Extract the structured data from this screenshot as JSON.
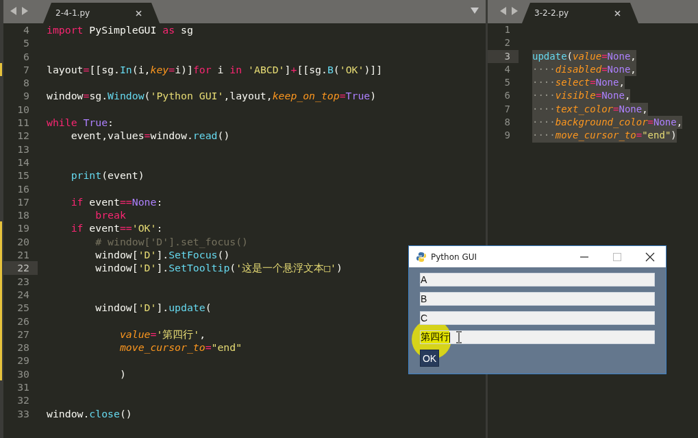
{
  "panes": [
    {
      "tabs": [
        {
          "label": "2-4-1.py",
          "selected": true
        }
      ],
      "lines": [
        {
          "number": "4",
          "current": false,
          "modified": false,
          "tokens": [
            {
              "text": "import",
              "kind": "kw"
            },
            {
              "text": " PySimpleGUI ",
              "kind": "plain"
            },
            {
              "text": "as",
              "kind": "kw"
            },
            {
              "text": " sg",
              "kind": "plain"
            }
          ]
        },
        {
          "number": "5",
          "current": false,
          "modified": false
        },
        {
          "number": "6",
          "current": false,
          "modified": false
        },
        {
          "number": "7",
          "current": false,
          "modified": true,
          "tokens": [
            {
              "text": "layout",
              "kind": "plain"
            },
            {
              "text": "=",
              "kind": "op"
            },
            {
              "text": "[[sg.",
              "kind": "plain"
            },
            {
              "text": "In",
              "kind": "fn"
            },
            {
              "text": "(i,",
              "kind": "plain"
            },
            {
              "text": "key",
              "kind": "param"
            },
            {
              "text": "=",
              "kind": "op"
            },
            {
              "text": "i)]",
              "kind": "plain"
            },
            {
              "text": "for",
              "kind": "kw"
            },
            {
              "text": " i ",
              "kind": "plain"
            },
            {
              "text": "in",
              "kind": "kw"
            },
            {
              "text": " 'ABCD'",
              "kind": "str"
            },
            {
              "text": "]",
              "kind": "plain"
            },
            {
              "text": "+",
              "kind": "op"
            },
            {
              "text": "[[sg.",
              "kind": "plain"
            },
            {
              "text": "B",
              "kind": "fn"
            },
            {
              "text": "(",
              "kind": "plain"
            },
            {
              "text": "'OK'",
              "kind": "str"
            },
            {
              "text": ")]]",
              "kind": "plain"
            }
          ]
        },
        {
          "number": "8",
          "current": false,
          "modified": false
        },
        {
          "number": "9",
          "current": false,
          "modified": false,
          "tokens": [
            {
              "text": "window",
              "kind": "plain"
            },
            {
              "text": "=",
              "kind": "op"
            },
            {
              "text": "sg.",
              "kind": "plain"
            },
            {
              "text": "Window",
              "kind": "fn"
            },
            {
              "text": "(",
              "kind": "plain"
            },
            {
              "text": "'Python GUI'",
              "kind": "str"
            },
            {
              "text": ",layout,",
              "kind": "plain"
            },
            {
              "text": "keep_on_top",
              "kind": "param"
            },
            {
              "text": "=",
              "kind": "op"
            },
            {
              "text": "True",
              "kind": "const"
            },
            {
              "text": ")",
              "kind": "plain"
            }
          ]
        },
        {
          "number": "10",
          "current": false,
          "modified": false
        },
        {
          "number": "11",
          "current": false,
          "modified": false,
          "tokens": [
            {
              "text": "while",
              "kind": "kw"
            },
            {
              "text": " True",
              "kind": "const"
            },
            {
              "text": ":",
              "kind": "plain"
            }
          ]
        },
        {
          "number": "12",
          "current": false,
          "modified": false,
          "tokens": [
            {
              "text": "    event,values",
              "kind": "plain"
            },
            {
              "text": "=",
              "kind": "op"
            },
            {
              "text": "window.",
              "kind": "plain"
            },
            {
              "text": "read",
              "kind": "fn"
            },
            {
              "text": "()",
              "kind": "plain"
            }
          ]
        },
        {
          "number": "13",
          "current": false,
          "modified": false
        },
        {
          "number": "14",
          "current": false,
          "modified": false
        },
        {
          "number": "15",
          "current": false,
          "modified": false,
          "tokens": [
            {
              "text": "    print",
              "kind": "fn"
            },
            {
              "text": "(event)",
              "kind": "plain"
            }
          ]
        },
        {
          "number": "16",
          "current": false,
          "modified": false
        },
        {
          "number": "17",
          "current": false,
          "modified": false,
          "tokens": [
            {
              "text": "    if",
              "kind": "kw"
            },
            {
              "text": " event",
              "kind": "plain"
            },
            {
              "text": "==",
              "kind": "op"
            },
            {
              "text": "None",
              "kind": "const"
            },
            {
              "text": ":",
              "kind": "plain"
            }
          ]
        },
        {
          "number": "18",
          "current": false,
          "modified": false,
          "tokens": [
            {
              "text": "        break",
              "kind": "kw"
            }
          ]
        },
        {
          "number": "19",
          "current": false,
          "modified": true,
          "tokens": [
            {
              "text": "    if",
              "kind": "kw"
            },
            {
              "text": " event",
              "kind": "plain"
            },
            {
              "text": "==",
              "kind": "op"
            },
            {
              "text": "'OK'",
              "kind": "str"
            },
            {
              "text": ":",
              "kind": "plain"
            }
          ]
        },
        {
          "number": "20",
          "current": false,
          "modified": true,
          "tokens": [
            {
              "text": "        # window['D'].set_focus()",
              "kind": "cm"
            }
          ]
        },
        {
          "number": "21",
          "current": false,
          "modified": true,
          "tokens": [
            {
              "text": "        window[",
              "kind": "plain"
            },
            {
              "text": "'D'",
              "kind": "str"
            },
            {
              "text": "].",
              "kind": "plain"
            },
            {
              "text": "SetFocus",
              "kind": "fn"
            },
            {
              "text": "()",
              "kind": "plain"
            }
          ]
        },
        {
          "number": "22",
          "current": true,
          "modified": true,
          "tokens": [
            {
              "text": "        window[",
              "kind": "plain"
            },
            {
              "text": "'D'",
              "kind": "str"
            },
            {
              "text": "].",
              "kind": "plain"
            },
            {
              "text": "SetTooltip",
              "kind": "fn"
            },
            {
              "text": "(",
              "kind": "plain"
            },
            {
              "text": "'这是一个悬浮文本□'",
              "kind": "str"
            },
            {
              "text": ")",
              "kind": "plain"
            }
          ]
        },
        {
          "number": "23",
          "current": false,
          "modified": true
        },
        {
          "number": "24",
          "current": false,
          "modified": true
        },
        {
          "number": "25",
          "current": false,
          "modified": true,
          "tokens": [
            {
              "text": "        window[",
              "kind": "plain"
            },
            {
              "text": "'D'",
              "kind": "str"
            },
            {
              "text": "].",
              "kind": "plain"
            },
            {
              "text": "update",
              "kind": "fn"
            },
            {
              "text": "(",
              "kind": "plain"
            }
          ]
        },
        {
          "number": "26",
          "current": false,
          "modified": true
        },
        {
          "number": "27",
          "current": false,
          "modified": true,
          "tokens": [
            {
              "text": "            value",
              "kind": "param"
            },
            {
              "text": "=",
              "kind": "op"
            },
            {
              "text": "'第四行'",
              "kind": "str"
            },
            {
              "text": ",",
              "kind": "plain"
            }
          ]
        },
        {
          "number": "28",
          "current": false,
          "modified": true,
          "tokens": [
            {
              "text": "            move_cursor_to",
              "kind": "param"
            },
            {
              "text": "=",
              "kind": "op"
            },
            {
              "text": "\"end\"",
              "kind": "str"
            }
          ]
        },
        {
          "number": "29",
          "current": false,
          "modified": true
        },
        {
          "number": "30",
          "current": false,
          "modified": true,
          "tokens": [
            {
              "text": "            )",
              "kind": "plain"
            }
          ]
        },
        {
          "number": "31",
          "current": false,
          "modified": false
        },
        {
          "number": "32",
          "current": false,
          "modified": false
        },
        {
          "number": "33",
          "current": false,
          "modified": false,
          "tokens": [
            {
              "text": "window.",
              "kind": "plain"
            },
            {
              "text": "close",
              "kind": "fn"
            },
            {
              "text": "()",
              "kind": "plain"
            }
          ]
        }
      ]
    },
    {
      "tabs": [
        {
          "label": "3-2-2.py",
          "selected": true
        }
      ],
      "lines": [
        {
          "number": "1",
          "current": false,
          "selected": false
        },
        {
          "number": "2",
          "current": false,
          "selected": false
        },
        {
          "number": "3",
          "current": true,
          "selected": true,
          "tokens": [
            {
              "text": "update",
              "kind": "fn"
            },
            {
              "text": "(",
              "kind": "plain"
            },
            {
              "text": "value",
              "kind": "param"
            },
            {
              "text": "=",
              "kind": "op"
            },
            {
              "text": "None",
              "kind": "const"
            },
            {
              "text": ",",
              "kind": "plain"
            }
          ]
        },
        {
          "number": "4",
          "current": false,
          "selected": true,
          "tokens": [
            {
              "text": "····",
              "kind": "ws"
            },
            {
              "text": "disabled",
              "kind": "param"
            },
            {
              "text": "=",
              "kind": "op"
            },
            {
              "text": "None",
              "kind": "const"
            },
            {
              "text": ",",
              "kind": "plain"
            }
          ]
        },
        {
          "number": "5",
          "current": false,
          "selected": true,
          "tokens": [
            {
              "text": "····",
              "kind": "ws"
            },
            {
              "text": "select",
              "kind": "param"
            },
            {
              "text": "=",
              "kind": "op"
            },
            {
              "text": "None",
              "kind": "const"
            },
            {
              "text": ",",
              "kind": "plain"
            }
          ]
        },
        {
          "number": "6",
          "current": false,
          "selected": true,
          "tokens": [
            {
              "text": "····",
              "kind": "ws"
            },
            {
              "text": "visible",
              "kind": "param"
            },
            {
              "text": "=",
              "kind": "op"
            },
            {
              "text": "None",
              "kind": "const"
            },
            {
              "text": ",",
              "kind": "plain"
            }
          ]
        },
        {
          "number": "7",
          "current": false,
          "selected": true,
          "tokens": [
            {
              "text": "····",
              "kind": "ws"
            },
            {
              "text": "text_color",
              "kind": "param"
            },
            {
              "text": "=",
              "kind": "op"
            },
            {
              "text": "None",
              "kind": "const"
            },
            {
              "text": ",",
              "kind": "plain"
            }
          ]
        },
        {
          "number": "8",
          "current": false,
          "selected": true,
          "tokens": [
            {
              "text": "····",
              "kind": "ws"
            },
            {
              "text": "background_color",
              "kind": "param"
            },
            {
              "text": "=",
              "kind": "op"
            },
            {
              "text": "None",
              "kind": "const"
            },
            {
              "text": ",",
              "kind": "plain"
            }
          ]
        },
        {
          "number": "9",
          "current": false,
          "selected": true,
          "tokens": [
            {
              "text": "····",
              "kind": "ws"
            },
            {
              "text": "move_cursor_to",
              "kind": "param"
            },
            {
              "text": "=",
              "kind": "op"
            },
            {
              "text": "\"end\"",
              "kind": "str"
            },
            {
              "text": ")",
              "kind": "plain"
            }
          ]
        }
      ]
    }
  ],
  "dialog": {
    "title": "Python GUI",
    "fields": [
      {
        "value": "A",
        "focused": false
      },
      {
        "value": "B",
        "focused": false
      },
      {
        "value": "C",
        "focused": false
      },
      {
        "value": "第四行",
        "focused": true
      }
    ],
    "button": "OK"
  }
}
